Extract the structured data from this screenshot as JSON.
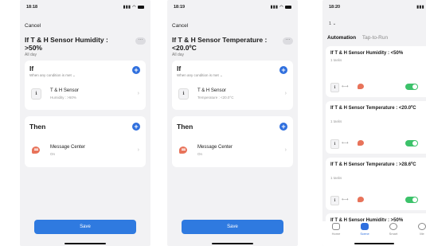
{
  "screens": [
    {
      "status_time": "18:18",
      "cancel": "Cancel",
      "title": "If T & H Sensor Humidity : >50%",
      "subtitle": "All day",
      "more": "···",
      "if_card": {
        "heading": "If",
        "condition": "When any condition is met ⌄",
        "item_name": "T & H Sensor",
        "item_value": "Humidity : >50%"
      },
      "then_card": {
        "heading": "Then",
        "item_name": "Message Center",
        "item_value": "On"
      },
      "save": "Save"
    },
    {
      "status_time": "18:19",
      "cancel": "Cancel",
      "title": "If T & H Sensor Temperature : <20.0ºC",
      "subtitle": "All day",
      "more": "···",
      "if_card": {
        "heading": "If",
        "condition": "When any condition is met ⌄",
        "item_name": "T & H Sensor",
        "item_value": "Temperature : <20.0°C"
      },
      "then_card": {
        "heading": "Then",
        "item_name": "Message Center",
        "item_value": "On"
      },
      "save": "Save"
    }
  ],
  "automation_list": {
    "status_time": "18:20",
    "count": "1 ⌄",
    "tabs": [
      "Automation",
      "Tap-to-Run"
    ],
    "cards": [
      {
        "title": "If T & H Sensor Humidity : <50%",
        "count": "1 tasks",
        "enabled": true
      },
      {
        "title": "If T & H Sensor Temperature : <20.0ºC",
        "count": "1 tasks",
        "enabled": true
      },
      {
        "title": "If T & H Sensor Temperature : >28.6ºC",
        "count": "1 tasks",
        "enabled": true
      },
      {
        "title": "If T & H Sensor Humidity : >50%",
        "count": "",
        "enabled": true
      }
    ],
    "nav": [
      "Home",
      "Scene",
      "Smart",
      "Me"
    ]
  },
  "colors": {
    "accent": "#2f6fde",
    "toggle_on": "#3cc26a",
    "chat": "#e8735a"
  }
}
